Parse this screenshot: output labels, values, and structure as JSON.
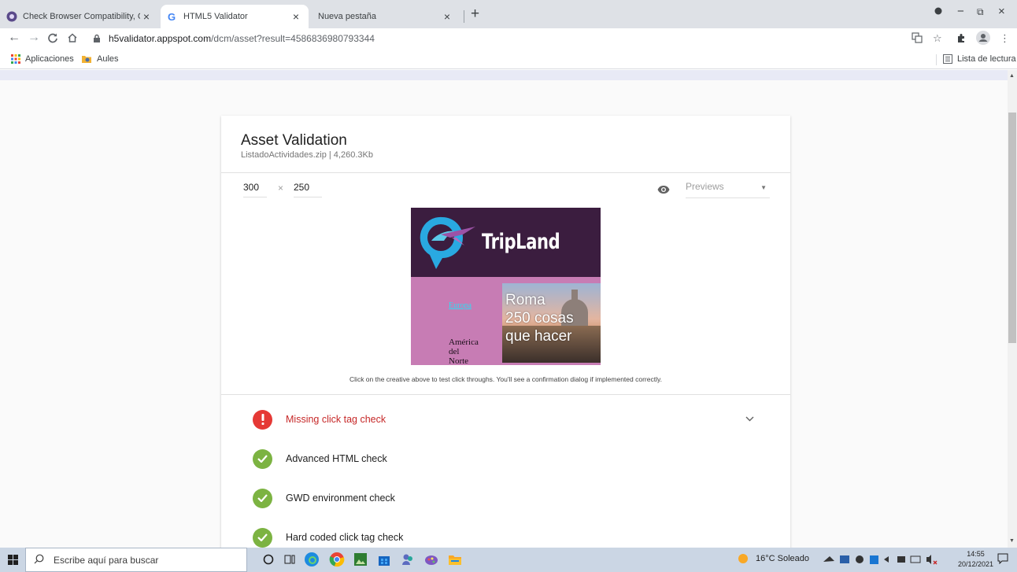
{
  "browser": {
    "tabs": [
      {
        "title": "Check Browser Compatibility, Cro",
        "close": "×"
      },
      {
        "title": "HTML5 Validator",
        "close": "×"
      },
      {
        "title": "Nueva pestaña",
        "close": "×"
      }
    ],
    "new_tab": "+",
    "window_controls": {
      "minimize": "−",
      "restore": "⧉",
      "close": "×"
    },
    "url_host": "h5validator.appspot.com",
    "url_path": "/dcm/asset?result=4586836980793344",
    "bookmarks": [
      {
        "label": "Aplicaciones",
        "icon": "apps-grid-icon"
      },
      {
        "label": "Aules",
        "icon": "folder-icon"
      }
    ],
    "reading_list": "Lista de lectura"
  },
  "asset": {
    "title": "Asset Validation",
    "subtitle": "ListadoActividades.zip | 4,260.3Kb",
    "width": "300",
    "times": "×",
    "height": "250",
    "previews_placeholder": "Previews",
    "click_note": "Click on the creative above to test click throughs. You'll see a confirmation dialog if implemented correctly."
  },
  "creative": {
    "brand": "TripLand",
    "link": "Europa",
    "nav_text_lines": [
      "América",
      "del",
      "Norte"
    ],
    "photo_lines": [
      "Roma",
      "250 cosas",
      "que hacer"
    ]
  },
  "checks": [
    {
      "label": "Missing click tag check",
      "status": "error",
      "color": "#e53935"
    },
    {
      "label": "Advanced HTML check",
      "status": "pass",
      "color": "#7cb342"
    },
    {
      "label": "GWD environment check",
      "status": "pass",
      "color": "#7cb342"
    },
    {
      "label": "Hard coded click tag check",
      "status": "pass",
      "color": "#7cb342"
    }
  ],
  "taskbar": {
    "search_placeholder": "Escribe aquí para buscar",
    "weather": "16°C  Soleado",
    "time": "14:55",
    "date": "20/12/2021"
  }
}
